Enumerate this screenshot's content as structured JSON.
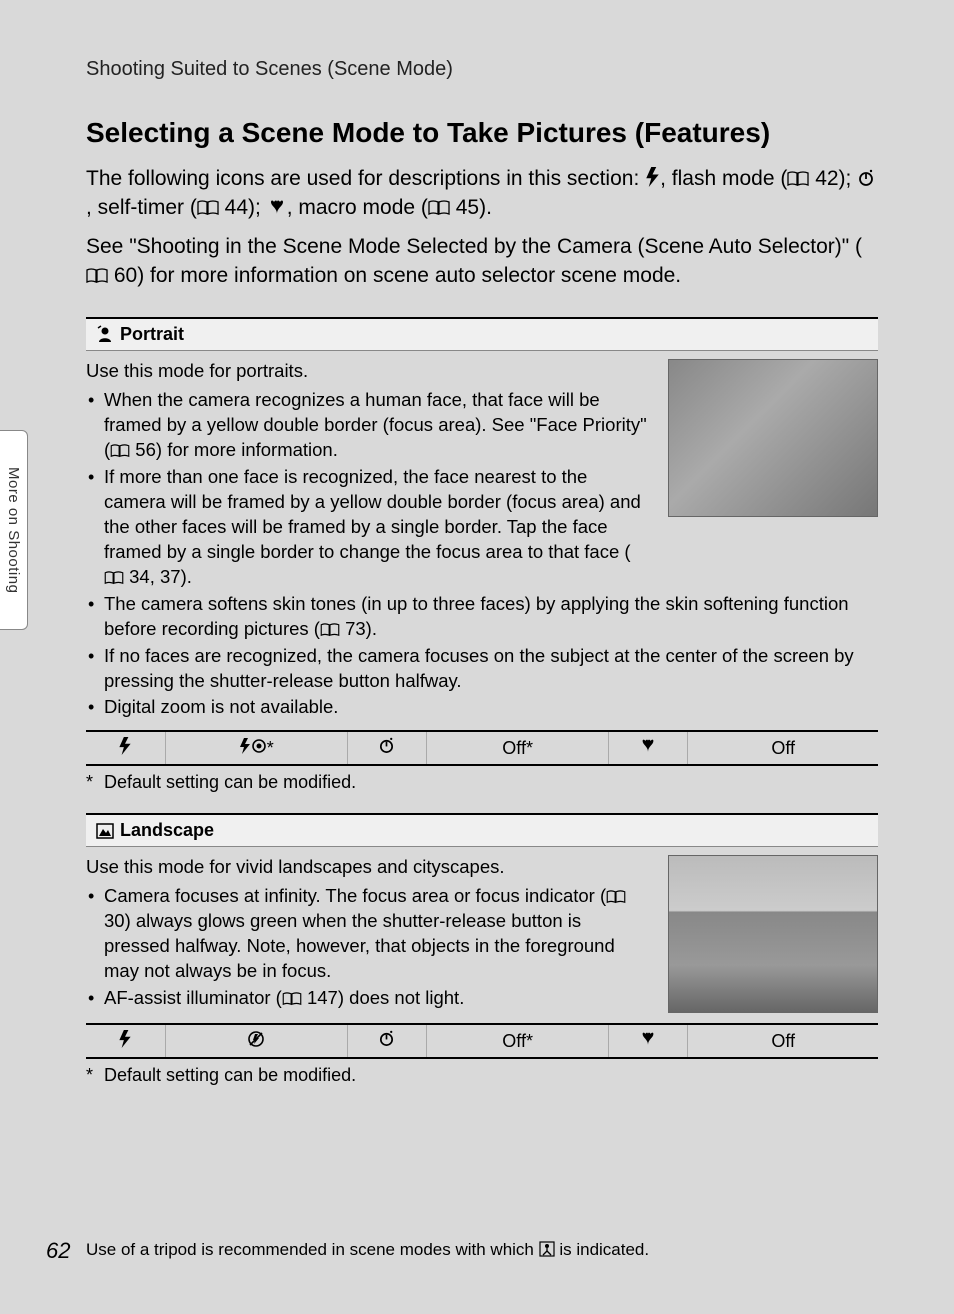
{
  "sideTab": "More on Shooting",
  "breadcrumb": "Shooting Suited to Scenes (Scene Mode)",
  "title": "Selecting a Scene Mode to Take Pictures (Features)",
  "intro_a": "The following icons are used for descriptions in this section: ",
  "intro_b": ", flash mode (",
  "intro_c": " 42); ",
  "intro_d": ", self-timer (",
  "intro_e": " 44); ",
  "intro_f": ", macro mode (",
  "intro_g": " 45).",
  "intro2_a": "See \"Shooting in the Scene Mode Selected by the Camera (Scene Auto Selector)\" (",
  "intro2_b": " 60) for more information on scene auto selector scene mode.",
  "portrait": {
    "header": "Portrait",
    "lead": "Use this mode for portraits.",
    "b1a": "When the camera recognizes a human face, that face will be framed by a yellow double border (focus area). See \"Face Priority\" (",
    "b1b": " 56) for more information.",
    "b2a": "If more than one face is recognized, the face nearest to the camera will be framed by a yellow double border (focus area) and the other faces will be framed by a single border. Tap the face framed by a single border to change the focus area to that face (",
    "b2b": " 34, 37).",
    "b3a": "The camera softens skin tones (in up to three faces) by applying the skin softening function before recording pictures (",
    "b3b": " 73).",
    "b4": "If no faces are recognized, the camera focuses on the subject at the center of the screen by pressing the shutter-release button halfway.",
    "b5": "Digital zoom is not available.",
    "table": {
      "flash_val": "*",
      "timer_val": "Off*",
      "macro_val": "Off"
    },
    "footnote": "Default setting can be modified."
  },
  "landscape": {
    "header": "Landscape",
    "lead": "Use this mode for vivid landscapes and cityscapes.",
    "b1a": "Camera focuses at infinity. The focus area or focus indicator (",
    "b1b": " 30) always glows green when the shutter-release button is pressed halfway. Note, however, that objects in the foreground may not always be in focus.",
    "b2a": "AF-assist illuminator (",
    "b2b": " 147) does not light.",
    "table": {
      "flash_val": "",
      "timer_val": "Off*",
      "macro_val": "Off"
    },
    "footnote": "Default setting can be modified."
  },
  "footer_a": "Use of a tripod is recommended in scene modes with which ",
  "footer_b": " is indicated.",
  "pageNum": "62"
}
